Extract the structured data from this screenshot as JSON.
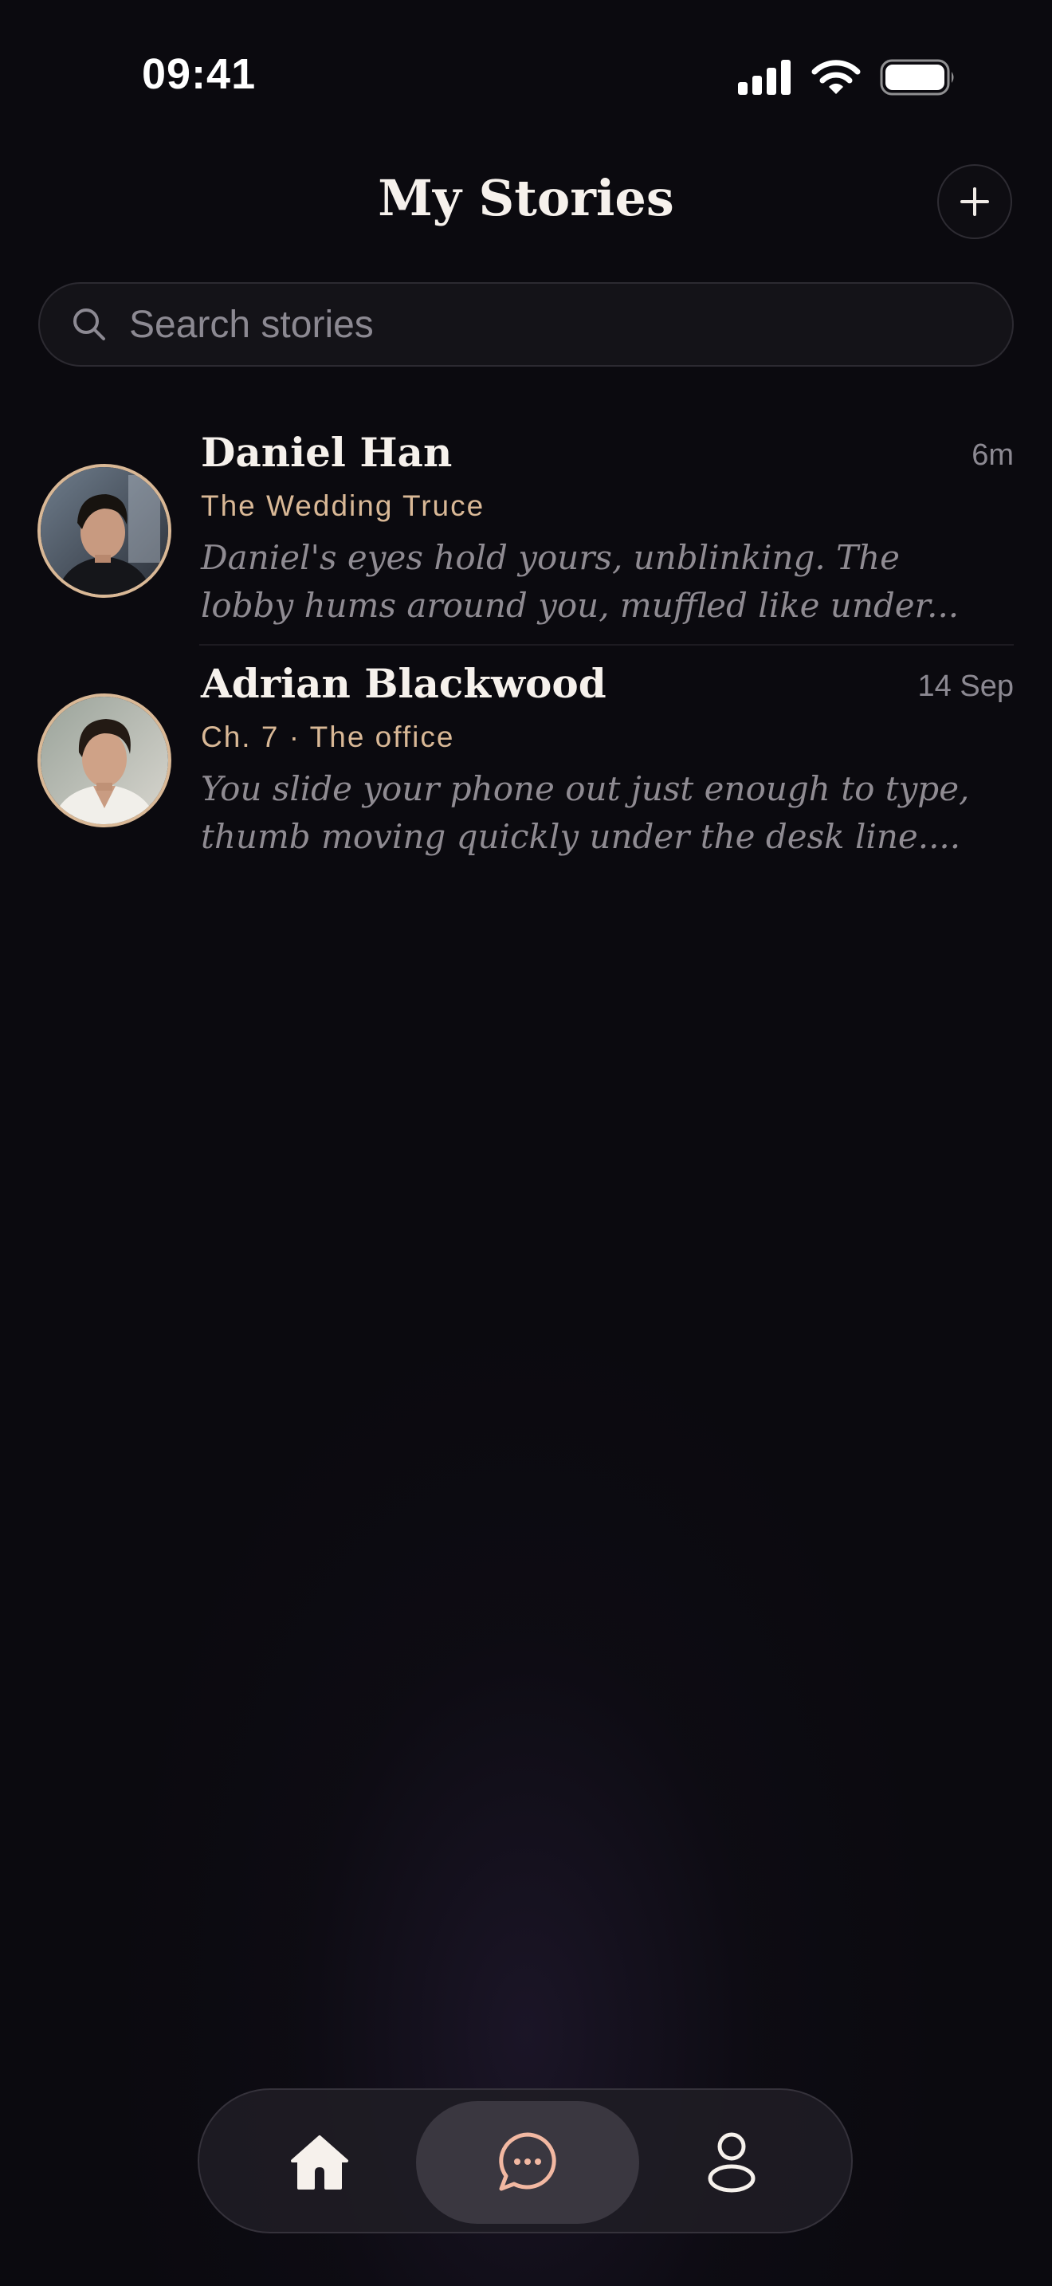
{
  "status_bar": {
    "time": "09:41",
    "icons": [
      "cellular-signal-icon",
      "wifi-icon",
      "battery-icon"
    ]
  },
  "header": {
    "title": "My Stories",
    "add_icon": "plus-icon"
  },
  "search": {
    "placeholder": "Search stories",
    "icon": "search-icon"
  },
  "stories": [
    {
      "name": "Daniel Han",
      "subtitle": "The Wedding Truce",
      "time": "6m",
      "preview_lines": [
        "Daniel's eyes hold yours, unblinking. The",
        "lobby hums around you, muffled like under..."
      ]
    },
    {
      "name": "Adrian Blackwood",
      "subtitle": "Ch. 7 · The office",
      "time": "14 Sep",
      "preview_lines": [
        "You slide your phone out just enough to type,",
        "thumb moving quickly under the desk line...."
      ]
    }
  ],
  "bottom_nav": {
    "items": [
      {
        "icon": "home-icon",
        "active": false
      },
      {
        "icon": "chat-bubble-icon",
        "active": true
      },
      {
        "icon": "profile-icon",
        "active": false
      }
    ]
  },
  "colors": {
    "background": "#0b0a0f",
    "accent": "#d9b896",
    "text_primary": "#f6f1ec",
    "text_secondary": "#8f8b92",
    "active_icon": "#f2b8a2"
  }
}
